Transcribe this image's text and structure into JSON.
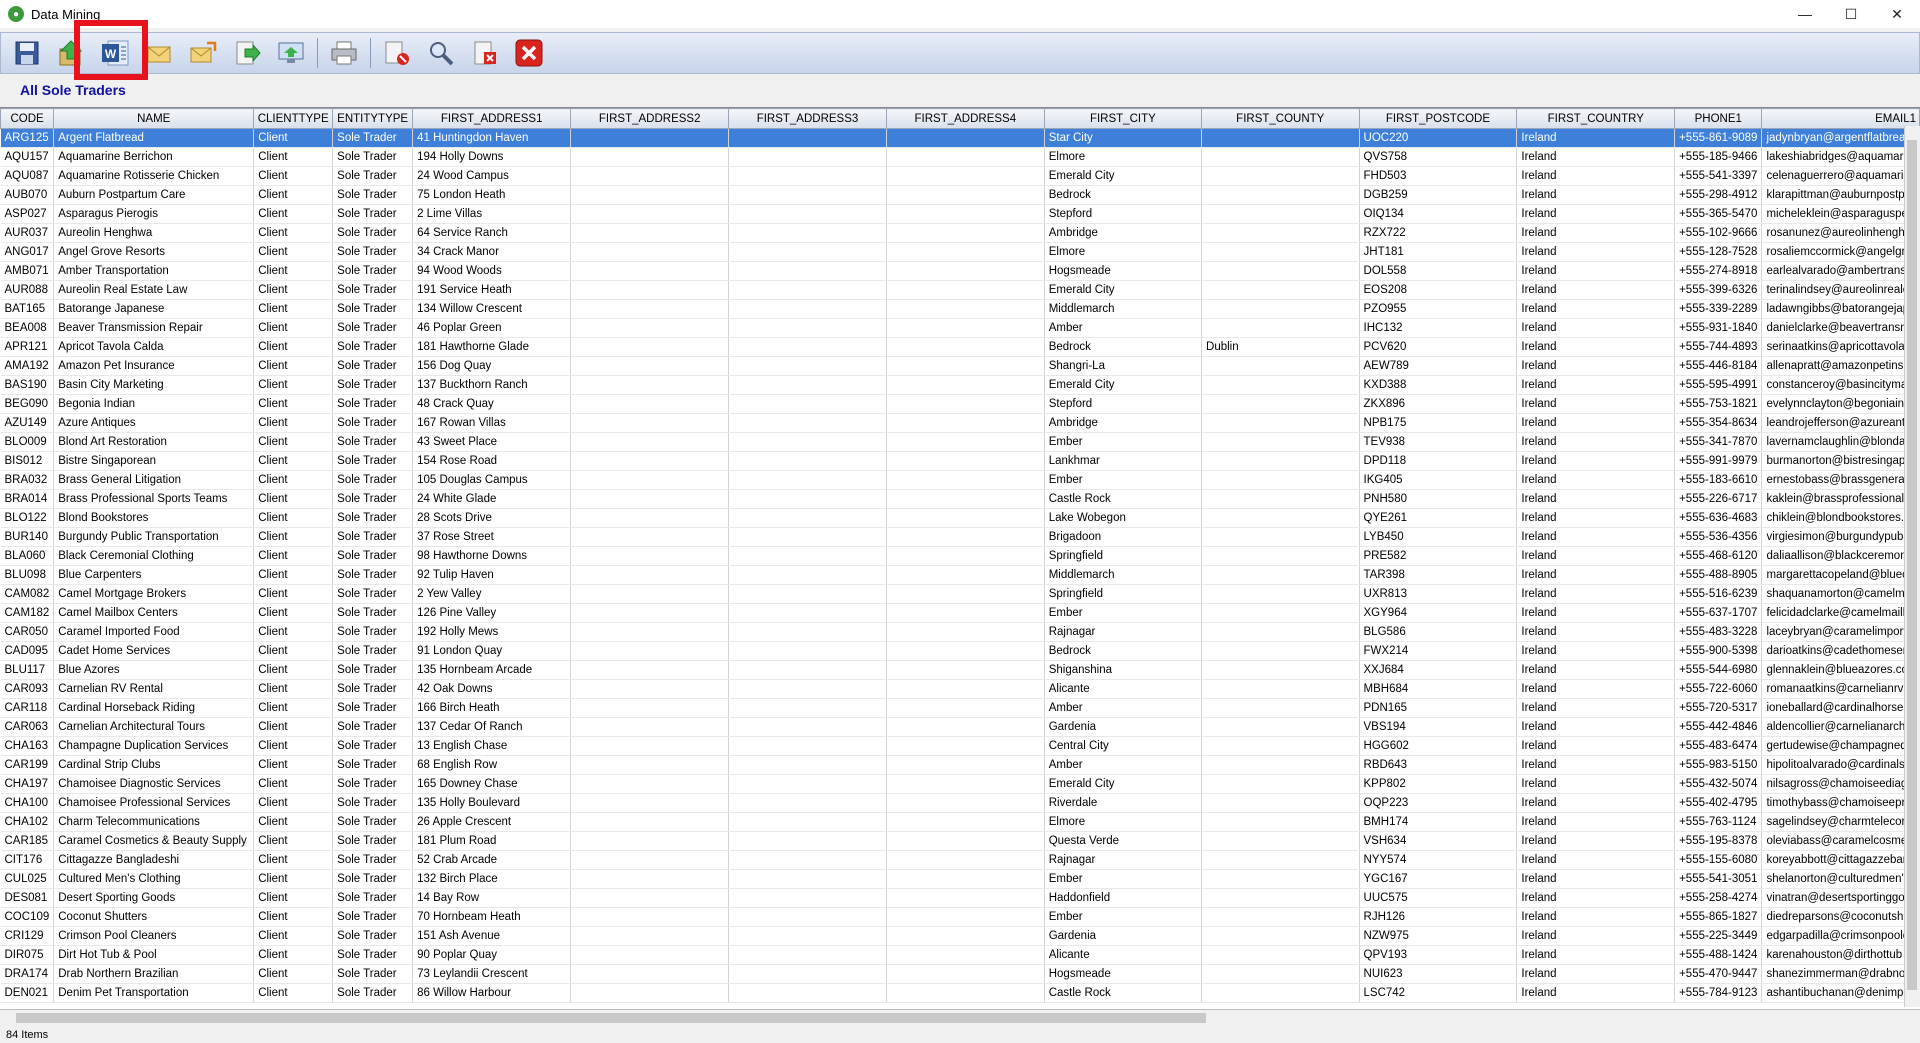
{
  "window": {
    "title": "Data Mining",
    "controls": [
      "—",
      "☐",
      "✕"
    ]
  },
  "toolbar": {
    "buttons": [
      "save-icon",
      "export-icon",
      "word-icon",
      "email-icon",
      "send-email-icon",
      "forward-icon",
      "monitor-icon",
      "print-icon",
      "delete-filter-icon",
      "search-icon",
      "delete-doc-icon",
      "close-icon"
    ]
  },
  "section_title": "All Sole Traders",
  "status": "84 Items",
  "columns": [
    "CODE",
    "NAME",
    "CLIENTTYPE",
    "ENTITYTYPE",
    "FIRST_ADDRESS1",
    "FIRST_ADDRESS2",
    "FIRST_ADDRESS3",
    "FIRST_ADDRESS4",
    "FIRST_CITY",
    "FIRST_COUNTY",
    "FIRST_POSTCODE",
    "FIRST_COUNTRY",
    "PHONE1",
    "EMAIL1"
  ],
  "rows": [
    [
      "ARG125",
      "Argent Flatbread",
      "Client",
      "Sole Trader",
      "41 Huntingdon Haven",
      "",
      "",
      "",
      "Star City",
      "",
      "UOC220",
      "Ireland",
      "+555-861-9089",
      "jadynbryan@argentflatbrea"
    ],
    [
      "AQU157",
      "Aquamarine Berrichon",
      "Client",
      "Sole Trader",
      "194 Holly Downs",
      "",
      "",
      "",
      "Elmore",
      "",
      "QVS758",
      "Ireland",
      "+555-185-9466",
      "lakeshiabridges@aquamarin"
    ],
    [
      "AQU087",
      "Aquamarine Rotisserie Chicken",
      "Client",
      "Sole Trader",
      "24 Wood Campus",
      "",
      "",
      "",
      "Emerald City",
      "",
      "FHD503",
      "Ireland",
      "+555-541-3397",
      "celenaguerrero@aquamarin"
    ],
    [
      "AUB070",
      "Auburn Postpartum Care",
      "Client",
      "Sole Trader",
      "75 London Heath",
      "",
      "",
      "",
      "Bedrock",
      "",
      "DGB259",
      "Ireland",
      "+555-298-4912",
      "klarapittman@auburnpostpa"
    ],
    [
      "ASP027",
      "Asparagus Pierogis",
      "Client",
      "Sole Trader",
      "2 Lime Villas",
      "",
      "",
      "",
      "Stepford",
      "",
      "OIQ134",
      "Ireland",
      "+555-365-5470",
      "micheleklein@asparagusper"
    ],
    [
      "AUR037",
      "Aureolin Henghwa",
      "Client",
      "Sole Trader",
      "64 Service Ranch",
      "",
      "",
      "",
      "Ambridge",
      "",
      "RZX722",
      "Ireland",
      "+555-102-9666",
      "rosanunez@aureolinhenghw"
    ],
    [
      "ANG017",
      "Angel Grove Resorts",
      "Client",
      "Sole Trader",
      "34 Crack Manor",
      "",
      "",
      "",
      "Elmore",
      "",
      "JHT181",
      "Ireland",
      "+555-128-7528",
      "rosaliemccormick@angelgro"
    ],
    [
      "AMB071",
      "Amber Transportation",
      "Client",
      "Sole Trader",
      "94 Wood Woods",
      "",
      "",
      "",
      "Hogsmeade",
      "",
      "DOL558",
      "Ireland",
      "+555-274-8918",
      "earlealvarado@ambertrans"
    ],
    [
      "AUR088",
      "Aureolin Real Estate Law",
      "Client",
      "Sole Trader",
      "191 Service Heath",
      "",
      "",
      "",
      "Emerald City",
      "",
      "EOS208",
      "Ireland",
      "+555-399-6326",
      "terinalindsey@aureolinreale"
    ],
    [
      "BAT165",
      "Batorange Japanese",
      "Client",
      "Sole Trader",
      "134 Willow Crescent",
      "",
      "",
      "",
      "Middlemarch",
      "",
      "PZO955",
      "Ireland",
      "+555-339-2289",
      "ladawngibbs@batorangejap"
    ],
    [
      "BEA008",
      "Beaver Transmission Repair",
      "Client",
      "Sole Trader",
      "46 Poplar Green",
      "",
      "",
      "",
      "Amber",
      "",
      "IHC132",
      "Ireland",
      "+555-931-1840",
      "danielclarke@beavertransm"
    ],
    [
      "APR121",
      "Apricot Tavola Calda",
      "Client",
      "Sole Trader",
      "181 Hawthorne Glade",
      "",
      "",
      "",
      "Bedrock",
      "Dublin",
      "PCV620",
      "Ireland",
      "+555-744-4893",
      "serinaatkins@apricottavolac"
    ],
    [
      "AMA192",
      "Amazon Pet Insurance",
      "Client",
      "Sole Trader",
      "156 Dog Quay",
      "",
      "",
      "",
      "Shangri-La",
      "",
      "AEW789",
      "Ireland",
      "+555-446-8184",
      "allenapratt@amazonpetinsu"
    ],
    [
      "BAS190",
      "Basin City Marketing",
      "Client",
      "Sole Trader",
      "137 Buckthorn Ranch",
      "",
      "",
      "",
      "Emerald City",
      "",
      "KXD388",
      "Ireland",
      "+555-595-4991",
      "constanceroy@basincitymar"
    ],
    [
      "BEG090",
      "Begonia Indian",
      "Client",
      "Sole Trader",
      "48 Crack Quay",
      "",
      "",
      "",
      "Stepford",
      "",
      "ZKX896",
      "Ireland",
      "+555-753-1821",
      "evelynnclayton@begoniainc"
    ],
    [
      "AZU149",
      "Azure Antiques",
      "Client",
      "Sole Trader",
      "167 Rowan Villas",
      "",
      "",
      "",
      "Ambridge",
      "",
      "NPB175",
      "Ireland",
      "+555-354-8634",
      "leandrojefferson@azureant"
    ],
    [
      "BLO009",
      "Blond Art Restoration",
      "Client",
      "Sole Trader",
      "43 Sweet Place",
      "",
      "",
      "",
      "Ember",
      "",
      "TEV938",
      "Ireland",
      "+555-341-7870",
      "lavernamclaughlin@blondar"
    ],
    [
      "BIS012",
      "Bistre Singaporean",
      "Client",
      "Sole Trader",
      "154 Rose Road",
      "",
      "",
      "",
      "Lankhmar",
      "",
      "DPD118",
      "Ireland",
      "+555-991-9979",
      "burmanorton@bistresingapc"
    ],
    [
      "BRA032",
      "Brass General Litigation",
      "Client",
      "Sole Trader",
      "105 Douglas Campus",
      "",
      "",
      "",
      "Ember",
      "",
      "IKG405",
      "Ireland",
      "+555-183-6610",
      "ernestobass@brassgenerall"
    ],
    [
      "BRA014",
      "Brass Professional Sports Teams",
      "Client",
      "Sole Trader",
      "24 White Glade",
      "",
      "",
      "",
      "Castle Rock",
      "",
      "PNH580",
      "Ireland",
      "+555-226-6717",
      "kaklein@brassprofessionals"
    ],
    [
      "BLO122",
      "Blond Bookstores",
      "Client",
      "Sole Trader",
      "28 Scots Drive",
      "",
      "",
      "",
      "Lake Wobegon",
      "",
      "QYE261",
      "Ireland",
      "+555-636-4683",
      "chiklein@blondbookstores.c"
    ],
    [
      "BUR140",
      "Burgundy Public Transportation",
      "Client",
      "Sole Trader",
      "37 Rose Street",
      "",
      "",
      "",
      "Brigadoon",
      "",
      "LYB450",
      "Ireland",
      "+555-536-4356",
      "virgiesimon@burgundypubli"
    ],
    [
      "BLA060",
      "Black Ceremonial Clothing",
      "Client",
      "Sole Trader",
      "98 Hawthorne Downs",
      "",
      "",
      "",
      "Springfield",
      "",
      "PRE582",
      "Ireland",
      "+555-468-6120",
      "daliaallison@blackceremoni"
    ],
    [
      "BLU098",
      "Blue Carpenters",
      "Client",
      "Sole Trader",
      "92 Tulip Haven",
      "",
      "",
      "",
      "Middlemarch",
      "",
      "TAR398",
      "Ireland",
      "+555-488-8905",
      "margarettacopeland@bluec"
    ],
    [
      "CAM082",
      "Camel Mortgage Brokers",
      "Client",
      "Sole Trader",
      "2 Yew Valley",
      "",
      "",
      "",
      "Springfield",
      "",
      "UXR813",
      "Ireland",
      "+555-516-6239",
      "shaquanamorton@camelmo"
    ],
    [
      "CAM182",
      "Camel Mailbox Centers",
      "Client",
      "Sole Trader",
      "126 Pine Valley",
      "",
      "",
      "",
      "Ember",
      "",
      "XGY964",
      "Ireland",
      "+555-637-1707",
      "felicidadclarke@camelmailbc"
    ],
    [
      "CAR050",
      "Caramel Imported Food",
      "Client",
      "Sole Trader",
      "192 Holly Mews",
      "",
      "",
      "",
      "Rajnagar",
      "",
      "BLG586",
      "Ireland",
      "+555-483-3228",
      "laceybryan@caramelimporte"
    ],
    [
      "CAD095",
      "Cadet Home Services",
      "Client",
      "Sole Trader",
      "91 London Quay",
      "",
      "",
      "",
      "Bedrock",
      "",
      "FWX214",
      "Ireland",
      "+555-900-5398",
      "darioatkins@cadethomeser"
    ],
    [
      "BLU117",
      "Blue Azores",
      "Client",
      "Sole Trader",
      "135 Hornbeam Arcade",
      "",
      "",
      "",
      "Shiganshina",
      "",
      "XXJ684",
      "Ireland",
      "+555-544-6980",
      "glennaklein@blueazores.cor"
    ],
    [
      "CAR093",
      "Carnelian RV Rental",
      "Client",
      "Sole Trader",
      "42 Oak Downs",
      "",
      "",
      "",
      "Alicante",
      "",
      "MBH684",
      "Ireland",
      "+555-722-6060",
      "romanaatkins@carnelianrv"
    ],
    [
      "CAR118",
      "Cardinal Horseback Riding",
      "Client",
      "Sole Trader",
      "166 Birch Heath",
      "",
      "",
      "",
      "Amber",
      "",
      "PDN165",
      "Ireland",
      "+555-720-5317",
      "ioneballard@cardinalhorseb"
    ],
    [
      "CAR063",
      "Carnelian Architectural Tours",
      "Client",
      "Sole Trader",
      "137 Cedar Of Ranch",
      "",
      "",
      "",
      "Gardenia",
      "",
      "VBS194",
      "Ireland",
      "+555-442-4846",
      "aldencollier@carnelianarchit"
    ],
    [
      "CHA163",
      "Champagne Duplication Services",
      "Client",
      "Sole Trader",
      "13 English Chase",
      "",
      "",
      "",
      "Central City",
      "",
      "HGG602",
      "Ireland",
      "+555-483-6474",
      "gertudewise@champagnedu"
    ],
    [
      "CAR199",
      "Cardinal Strip Clubs",
      "Client",
      "Sole Trader",
      "68 English Row",
      "",
      "",
      "",
      "Amber",
      "",
      "RBD643",
      "Ireland",
      "+555-983-5150",
      "hipolitoalvarado@cardinalst"
    ],
    [
      "CHA197",
      "Chamoisee Diagnostic Services",
      "Client",
      "Sole Trader",
      "165 Downey Chase",
      "",
      "",
      "",
      "Emerald City",
      "",
      "KPP802",
      "Ireland",
      "+555-432-5074",
      "nilsagross@chamoiseediagn"
    ],
    [
      "CHA100",
      "Chamoisee Professional Services",
      "Client",
      "Sole Trader",
      "135 Holly Boulevard",
      "",
      "",
      "",
      "Riverdale",
      "",
      "OQP223",
      "Ireland",
      "+555-402-4795",
      "timothybass@chamoiseeprc"
    ],
    [
      "CHA102",
      "Charm Telecommunications",
      "Client",
      "Sole Trader",
      "26 Apple Crescent",
      "",
      "",
      "",
      "Elmore",
      "",
      "BMH174",
      "Ireland",
      "+555-763-1124",
      "sagelindsey@charmtelecom"
    ],
    [
      "CAR185",
      "Caramel Cosmetics & Beauty Supply",
      "Client",
      "Sole Trader",
      "181 Plum Road",
      "",
      "",
      "",
      "Questa Verde",
      "",
      "VSH634",
      "Ireland",
      "+555-195-8378",
      "oleviabass@caramelcosmeti"
    ],
    [
      "CIT176",
      "Cittagazze Bangladeshi",
      "Client",
      "Sole Trader",
      "52 Crab Arcade",
      "",
      "",
      "",
      "Rajnagar",
      "",
      "NYY574",
      "Ireland",
      "+555-155-6080",
      "koreyabbott@cittagazzebar"
    ],
    [
      "CUL025",
      "Cultured Men's Clothing",
      "Client",
      "Sole Trader",
      "132 Birch Place",
      "",
      "",
      "",
      "Ember",
      "",
      "YGC167",
      "Ireland",
      "+555-541-3051",
      "shelanorton@culturedmen's"
    ],
    [
      "DES081",
      "Desert Sporting Goods",
      "Client",
      "Sole Trader",
      "14 Bay Row",
      "",
      "",
      "",
      "Haddonfield",
      "",
      "UUC575",
      "Ireland",
      "+555-258-4274",
      "vinatran@desertsportinggo"
    ],
    [
      "COC109",
      "Coconut Shutters",
      "Client",
      "Sole Trader",
      "70 Hornbeam Heath",
      "",
      "",
      "",
      "Ember",
      "",
      "RJH126",
      "Ireland",
      "+555-865-1827",
      "diedreparsons@coconutshu"
    ],
    [
      "CRI129",
      "Crimson Pool Cleaners",
      "Client",
      "Sole Trader",
      "151 Ash Avenue",
      "",
      "",
      "",
      "Gardenia",
      "",
      "NZW975",
      "Ireland",
      "+555-225-3449",
      "edgarpadilla@crimsonpoolc"
    ],
    [
      "DIR075",
      "Dirt Hot Tub & Pool",
      "Client",
      "Sole Trader",
      "90 Poplar Quay",
      "",
      "",
      "",
      "Alicante",
      "",
      "QPV193",
      "Ireland",
      "+555-488-1424",
      "karenahouston@dirthottub"
    ],
    [
      "DRA174",
      "Drab Northern Brazilian",
      "Client",
      "Sole Trader",
      "73 Leylandii Crescent",
      "",
      "",
      "",
      "Hogsmeade",
      "",
      "NUI623",
      "Ireland",
      "+555-470-9447",
      "shanezimmerman@drabnort"
    ],
    [
      "DEN021",
      "Denim Pet Transportation",
      "Client",
      "Sole Trader",
      "86 Willow Harbour",
      "",
      "",
      "",
      "Castle Rock",
      "",
      "LSC742",
      "Ireland",
      "+555-784-9123",
      "ashantibuchanan@denimpe"
    ]
  ]
}
